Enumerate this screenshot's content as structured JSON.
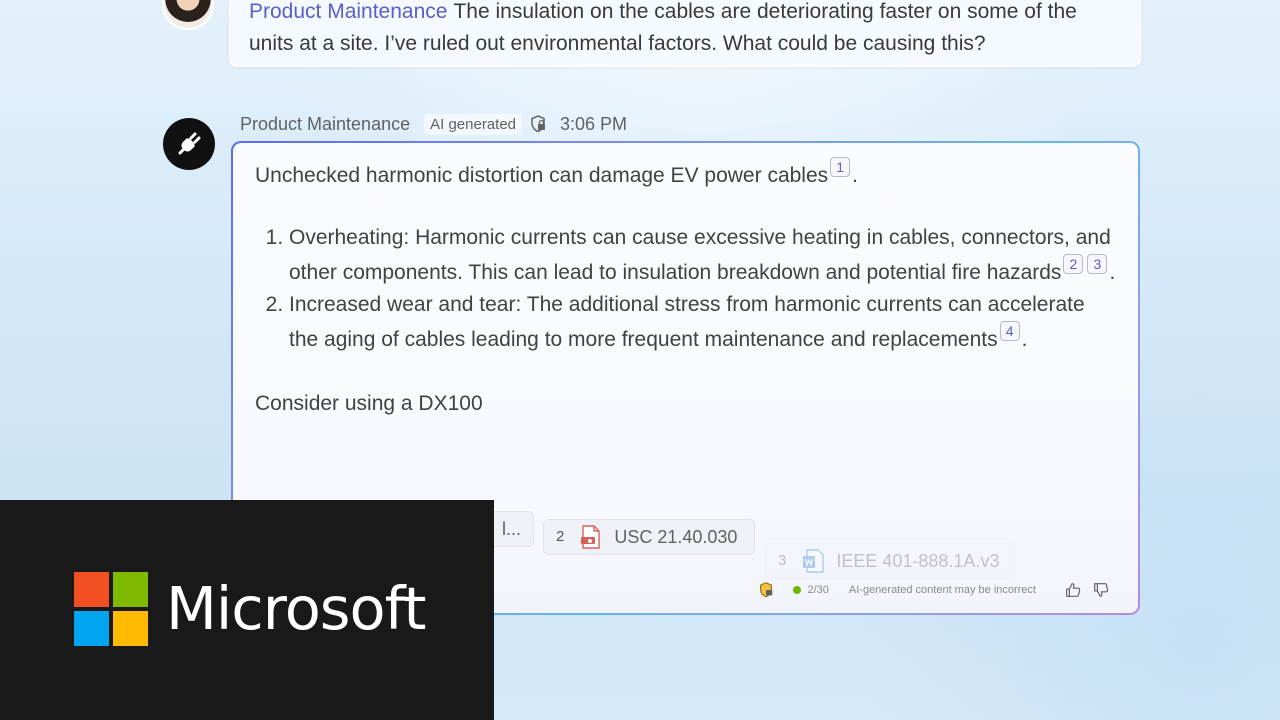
{
  "user_message": {
    "sender": "Product Maintenance",
    "text": "The insulation on the cables are deteriorating faster on some of the units at a site.  I’ve ruled out environmental factors.  What could be causing this?"
  },
  "bot_message": {
    "sender": "Product Maintenance",
    "ai_tag": "AI generated",
    "time": "3:06 PM",
    "intro": "Unchecked harmonic distortion can damage EV power cables",
    "intro_cite": "1",
    "points": [
      {
        "number": "1.",
        "text": "Overheating: Harmonic currents can cause excessive heating in cables, connectors, and other components. This can lead to insulation breakdown and potential fire hazards",
        "cites": [
          "2",
          "3"
        ]
      },
      {
        "number": "2.",
        "text": "Increased wear and tear: The additional stress from harmonic currents can accelerate the aging of cables leading to more frequent maintenance and replacements",
        "cites": [
          "4"
        ]
      }
    ],
    "consider": "Consider using a DX100",
    "references": [
      {
        "label": "l...",
        "number": ""
      },
      {
        "number": "2",
        "label": "USC 21.40.030",
        "icon": "pdf-file-icon"
      },
      {
        "number": "3",
        "label": "IEEE 401-888.1A.v3",
        "icon": "word-file-icon"
      }
    ],
    "footer": {
      "counter": "2/30",
      "disclaimer": "AI-generated content may be incorrect"
    }
  },
  "brand": {
    "name": "Microsoft",
    "colors": [
      "#f25022",
      "#7fba00",
      "#00a4ef",
      "#ffb900"
    ]
  }
}
